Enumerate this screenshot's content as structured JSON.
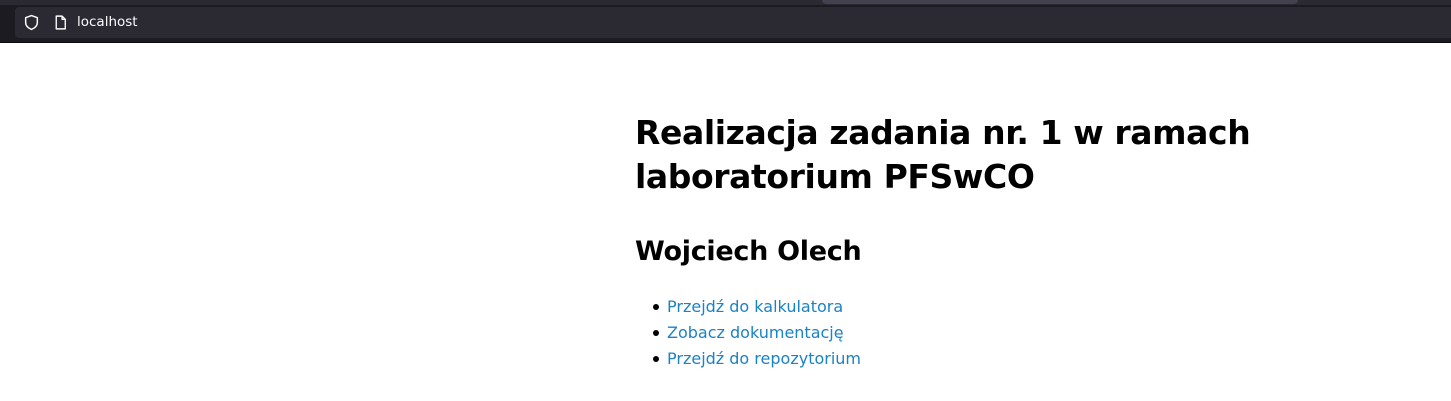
{
  "browser": {
    "url": "localhost",
    "icons": [
      "shield-icon",
      "page-icon"
    ]
  },
  "page": {
    "title": "Realizacja zadania nr. 1 w ramach laboratorium PFSwCO",
    "author": "Wojciech Olech",
    "links": [
      {
        "label": "Przejdź do kalkulatora"
      },
      {
        "label": "Zobacz dokumentację"
      },
      {
        "label": "Przejdź do repozytorium"
      }
    ],
    "colors": {
      "link": "#1b82c4",
      "chrome": "#1c1b22",
      "url_bar": "#2b2a33"
    }
  }
}
